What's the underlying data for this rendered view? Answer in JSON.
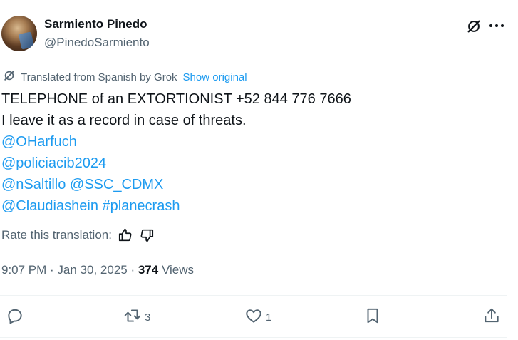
{
  "author": {
    "display_name": "Sarmiento Pinedo",
    "handle": "@PinedoSarmiento"
  },
  "header_icons": [
    "grok-icon",
    "more-icon"
  ],
  "translation": {
    "label": "Translated from Spanish by Grok",
    "show_original": "Show original"
  },
  "tweet": {
    "line1": "TELEPHONE of an EXTORTIONIST +52 844 776 7666",
    "line2": "I leave it as a record in case of threats.",
    "mention1": "@OHarfuch",
    "mention2": "@policiacib2024",
    "mention3": "@nSaltillo",
    "mention4": "@SSC_CDMX",
    "mention5": "@Claudiashein",
    "hashtag1": "#planecrash"
  },
  "rate": {
    "label": "Rate this translation:"
  },
  "meta": {
    "time": "9:07 PM",
    "date": "Jan 30, 2025",
    "sep1": " · ",
    "sep2": " · ",
    "views_count": "374",
    "views_label": "Views"
  },
  "actions": {
    "reply_count": "",
    "retweet_count": "3",
    "like_count": "1"
  },
  "colors": {
    "link": "#1d9bf0",
    "text": "#0f1419",
    "secondary": "#536471"
  }
}
